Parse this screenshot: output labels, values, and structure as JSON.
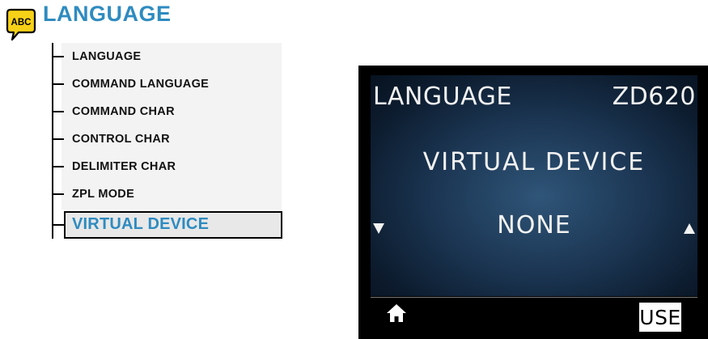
{
  "header": {
    "logo_text": "ABC",
    "title": "LANGUAGE"
  },
  "menu": {
    "items": [
      {
        "label": "LANGUAGE"
      },
      {
        "label": "COMMAND LANGUAGE"
      },
      {
        "label": "COMMAND CHAR"
      },
      {
        "label": "CONTROL CHAR"
      },
      {
        "label": "DELIMITER CHAR"
      },
      {
        "label": "ZPL MODE"
      },
      {
        "label": "VIRTUAL DEVICE",
        "selected": true
      }
    ]
  },
  "lcd": {
    "title_left": "LANGUAGE",
    "title_right": "ZD620",
    "menu_name": "VIRTUAL DEVICE",
    "value": "NONE",
    "left_arrow_icon": "down-arrow-icon",
    "right_arrow_icon": "up-arrow-icon",
    "home_icon": "home-icon",
    "use_label": "USE"
  },
  "colors": {
    "accent": "#2e8bc0",
    "logo_fill": "#f7d117",
    "lcd_bg": "#1b3552"
  }
}
